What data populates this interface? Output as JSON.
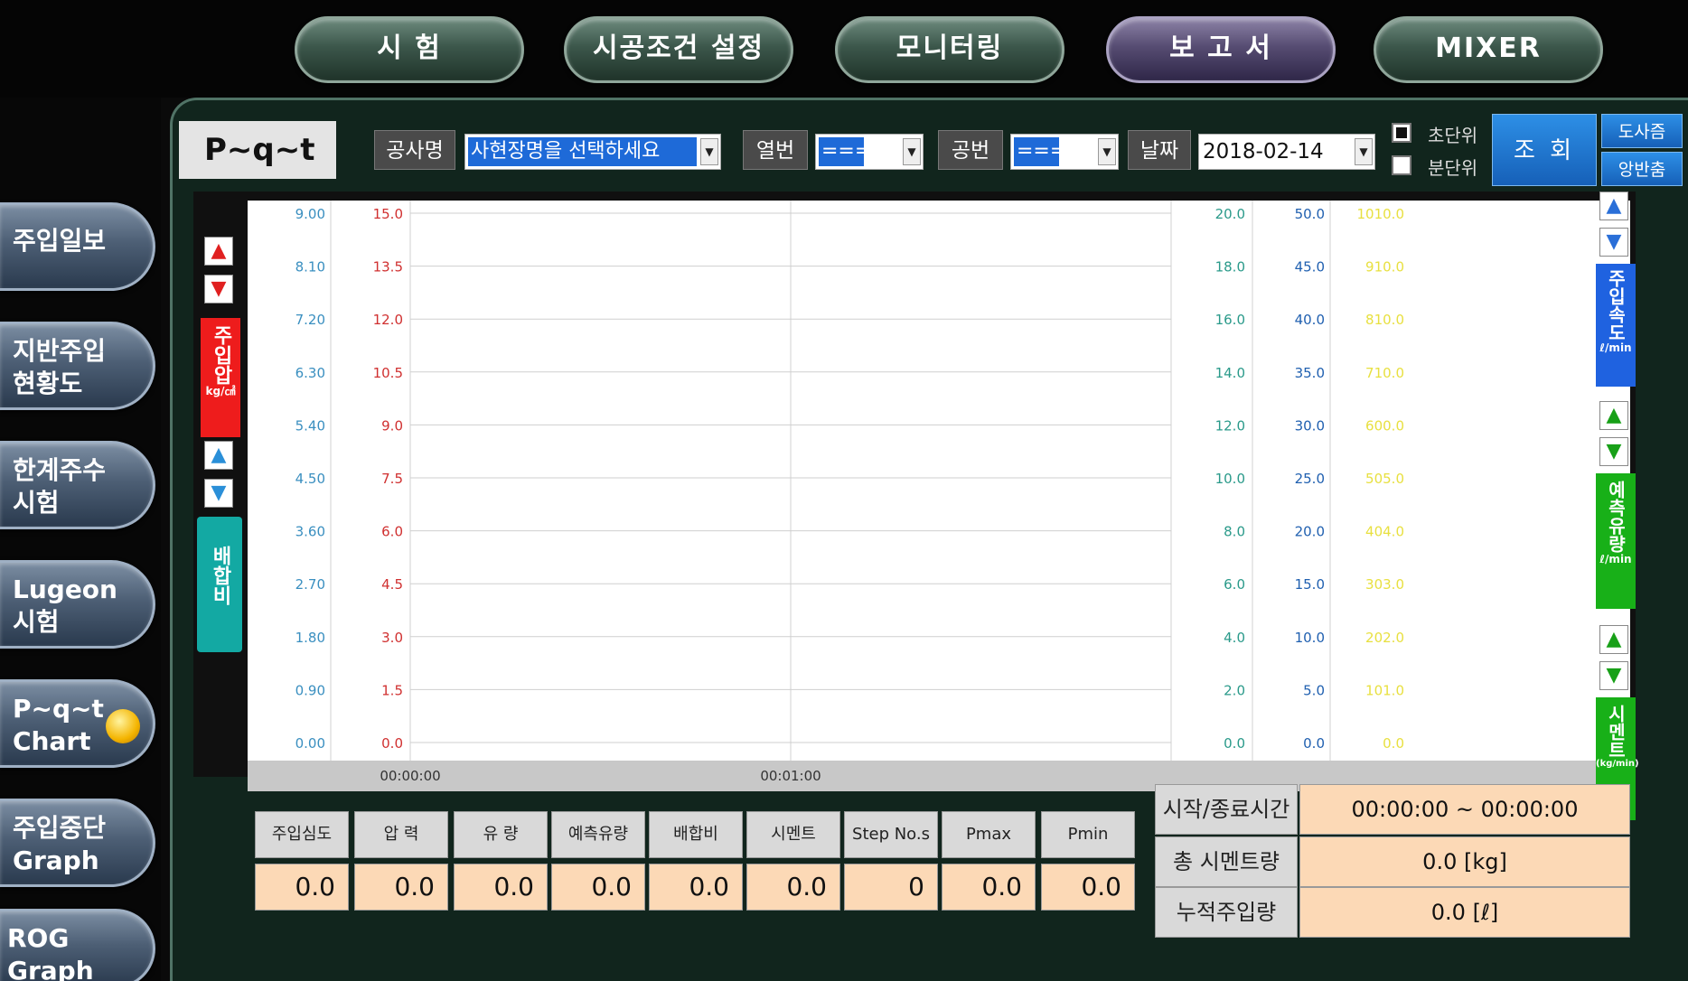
{
  "nav": [
    {
      "label": "시   험",
      "active": false
    },
    {
      "label": "시공조건 설정",
      "active": false
    },
    {
      "label": "모니터링",
      "active": false
    },
    {
      "label": "보 고 서",
      "active": true
    },
    {
      "label": "MIXER",
      "active": false
    }
  ],
  "sidebar": [
    {
      "line1": "주입일보",
      "line2": ""
    },
    {
      "line1": "지반주입",
      "line2": "현황도"
    },
    {
      "line1": "한계주수",
      "line2": "시험"
    },
    {
      "line1": "Lugeon",
      "line2": "시험"
    },
    {
      "line1": "P~q~t",
      "line2": "Chart"
    },
    {
      "line1": "주입중단",
      "line2": "Graph"
    },
    {
      "line1": "ROG",
      "line2": "Graph"
    }
  ],
  "header": {
    "title": "P~q~t",
    "project_label": "공사명",
    "project_value": "사현장명을 선택하세요",
    "row_label": "열번",
    "row_value": "===",
    "hole_label": "공번",
    "hole_value": "===",
    "date_label": "날짜",
    "date_value": "2018-02-14",
    "sec_unit": "초단위",
    "min_unit": "분단위",
    "sec_checked": true,
    "min_checked": false,
    "query_label": "조 회",
    "print_label": "도사즘",
    "default_label": "앙반춤"
  },
  "chart_data": {
    "type": "line",
    "x_ticks": [
      "00:00:00",
      "00:01:00"
    ],
    "axes": {
      "depth": {
        "ticks": [
          "9.00",
          "8.10",
          "7.20",
          "6.30",
          "5.40",
          "4.50",
          "3.60",
          "2.70",
          "1.80",
          "0.90",
          "0.00"
        ],
        "color": "#3a8fc0"
      },
      "pressure": {
        "ticks": [
          "15.0",
          "13.5",
          "12.0",
          "10.5",
          "9.0",
          "7.5",
          "6.0",
          "4.5",
          "3.0",
          "1.5",
          "0.0"
        ],
        "color": "#d03030"
      },
      "flow": {
        "ticks": [
          "20.0",
          "18.0",
          "16.0",
          "14.0",
          "12.0",
          "10.0",
          "8.0",
          "6.0",
          "4.0",
          "2.0",
          "0.0"
        ],
        "color": "#2a9a8a"
      },
      "pred_flow": {
        "ticks": [
          "50.0",
          "45.0",
          "40.0",
          "35.0",
          "30.0",
          "25.0",
          "20.0",
          "15.0",
          "10.0",
          "5.0",
          "0.0"
        ],
        "color": "#2060b0"
      },
      "cement": {
        "ticks": [
          "1010.0",
          "910.0",
          "810.0",
          "710.0",
          "600.0",
          "505.0",
          "404.0",
          "303.0",
          "202.0",
          "101.0",
          "0.0"
        ],
        "color": "#e8e040"
      }
    },
    "series": []
  },
  "side": {
    "pressure_label": "주입압",
    "pressure_unit": "kg/㎠",
    "mix_label": "배합비",
    "speed_label": "주입속도",
    "speed_unit": "ℓ/min",
    "pred_label": "예측유량",
    "pred_unit": "ℓ/min",
    "cement_label": "시멘트",
    "cement_unit": "(kg/min)"
  },
  "table": {
    "headers": [
      "주입심도",
      "압 력",
      "유 량",
      "예측유량",
      "배합비",
      "시멘트",
      "Step No.s",
      "Pmax",
      "Pmin"
    ],
    "values": [
      "0.0",
      "0.0",
      "0.0",
      "0.0",
      "0.0",
      "0.0",
      "0",
      "0.0",
      "0.0"
    ]
  },
  "summary": {
    "time_label": "시작/종료시간",
    "time_value": "00:00:00 ~ 00:00:00",
    "cement_label": "총 시멘트량",
    "cement_value": "0.0 [kg]",
    "inject_label": "누적주입량",
    "inject_value": "0.0 [ℓ]"
  }
}
